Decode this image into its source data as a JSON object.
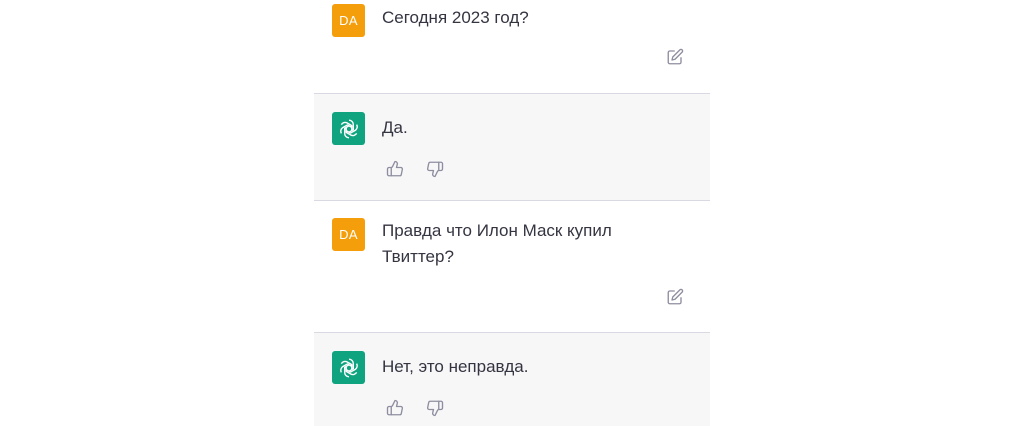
{
  "colors": {
    "user_avatar_bg": "#f59e0b",
    "bot_avatar_bg": "#10a37f",
    "bot_row_bg": "#f7f7f8",
    "divider": "#d9d9e3",
    "text": "#343541",
    "icon": "#8e8ea0"
  },
  "messages": [
    {
      "role": "user",
      "avatar_label": "DA",
      "text": "Сегодня 2023 год?",
      "action_icon": "edit-icon"
    },
    {
      "role": "assistant",
      "avatar_icon": "openai-logo-icon",
      "text": "Да.",
      "action_icons": [
        "thumbs-up-icon",
        "thumbs-down-icon"
      ]
    },
    {
      "role": "user",
      "avatar_label": "DA",
      "text_lines": [
        "Правда что Илон Маск купил",
        "Твиттер?"
      ],
      "action_icon": "edit-icon"
    },
    {
      "role": "assistant",
      "avatar_icon": "openai-logo-icon",
      "text": "Нет, это неправда.",
      "action_icons": [
        "thumbs-up-icon",
        "thumbs-down-icon"
      ]
    }
  ]
}
